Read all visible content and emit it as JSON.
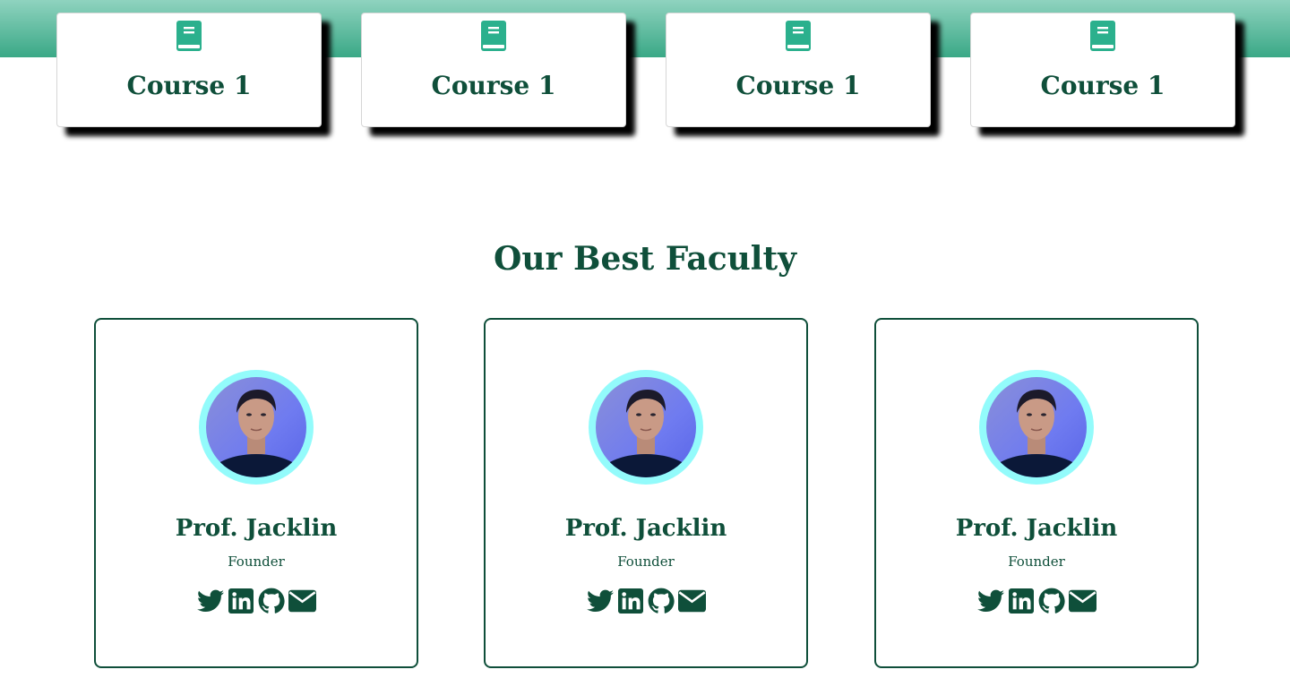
{
  "courses": [
    {
      "title": "Course 1",
      "icon": "book-icon"
    },
    {
      "title": "Course 1",
      "icon": "book-icon"
    },
    {
      "title": "Course 1",
      "icon": "book-icon"
    },
    {
      "title": "Course 1",
      "icon": "book-icon"
    }
  ],
  "faculty_section": {
    "title": "Our Best Faculty",
    "members": [
      {
        "name": "Prof. Jacklin",
        "role": "Founder",
        "socials": [
          "twitter-icon",
          "linkedin-icon",
          "github-icon",
          "envelope-icon"
        ]
      },
      {
        "name": "Prof. Jacklin",
        "role": "Founder",
        "socials": [
          "twitter-icon",
          "linkedin-icon",
          "github-icon",
          "envelope-icon"
        ]
      },
      {
        "name": "Prof. Jacklin",
        "role": "Founder",
        "socials": [
          "twitter-icon",
          "linkedin-icon",
          "github-icon",
          "envelope-icon"
        ]
      }
    ]
  },
  "colors": {
    "primary": "#0f4f3a",
    "accent": "#3aa886",
    "avatar_ring": "#93fbfb"
  }
}
